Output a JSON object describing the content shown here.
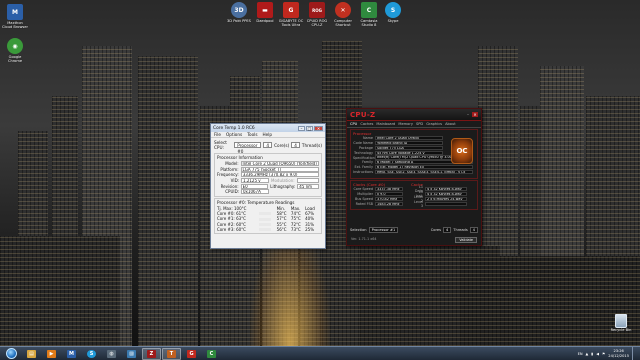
{
  "desktop_icons_left": [
    {
      "label": "Maxthon Cloud Browser",
      "glyph": "M",
      "color": "#2b5fa8",
      "icon": "maxthon-icon"
    },
    {
      "label": "Google Chrome",
      "glyph": "◉",
      "color": "#3a9a3a",
      "icon": "chrome-icon"
    }
  ],
  "desktop_icons_top": [
    {
      "label": "3D Pokt PPES",
      "glyph": "3D",
      "color": "#4a6fa0",
      "icon": "app-icon"
    },
    {
      "label": "Daedpool",
      "glyph": "▬",
      "color": "#b01a1a",
      "icon": "game-icon"
    },
    {
      "label": "GIGABYTE OC Tools Ultra",
      "glyph": "G",
      "color": "#c0281e",
      "icon": "gigabyte-icon"
    },
    {
      "label": "CPUID ROG CPU-Z",
      "glyph": "ROG",
      "color": "#9e1a1a",
      "icon": "cpuz-icon"
    },
    {
      "label": "Computer Shortcut",
      "glyph": "✕",
      "color": "#c03020",
      "icon": "computer-icon"
    },
    {
      "label": "Camtasia Studio 8",
      "glyph": "C",
      "color": "#2f8a3e",
      "icon": "camtasia-icon"
    },
    {
      "label": "Skype",
      "glyph": "S",
      "color": "#1f9ad8",
      "icon": "skype-icon"
    }
  ],
  "coretemp": {
    "title": "Core Temp 1.0 RC6",
    "menu": [
      "File",
      "Options",
      "Tools",
      "Help"
    ],
    "select_cpu_label": "Select CPU:",
    "select_cpu_value": "Processor #0",
    "cores_value": "4",
    "cores_label": "Core(s)",
    "threads_value": "4",
    "threads_label": "Thread(s)",
    "info_header": "Processor Information",
    "model_label": "Model:",
    "model_value": "Intel Core 2 Quad (Q9650) (Yorkfield)",
    "platform_label": "Platform:",
    "platform_value": "LGA 775 (Socket T)",
    "frequency_label": "Frequency:",
    "frequency_value": "3336.29MHz (370.82 x 9.0)",
    "vid_label": "VID:",
    "vid_value": "1.2125 v",
    "modulation_label": "Modulation:",
    "revision_label": "Revision:",
    "revision_value": "E0",
    "lithography_label": "Lithography:",
    "lithography_value": "45 nm",
    "cpuid_label": "CPUID:",
    "cpuid_value": "0x1067A",
    "temps_header": "Processor #0: Temperature Readings",
    "tj_label": "Tj. Max:",
    "tj_value": "100°C",
    "col_min": "Min.",
    "col_max": "Max.",
    "col_load": "Load",
    "cores": [
      {
        "name": "Core #0:",
        "temp": "61°C",
        "min": "58°C",
        "max": "74°C",
        "load": "67%"
      },
      {
        "name": "Core #1:",
        "temp": "63°C",
        "min": "57°C",
        "max": "75°C",
        "load": "40%"
      },
      {
        "name": "Core #2:",
        "temp": "60°C",
        "min": "55°C",
        "max": "72°C",
        "load": "31%"
      },
      {
        "name": "Core #3:",
        "temp": "60°C",
        "min": "56°C",
        "max": "73°C",
        "load": "25%"
      }
    ]
  },
  "cpuz": {
    "logo": "CPU-Z",
    "tabs": [
      "CPU",
      "Caches",
      "Mainboard",
      "Memory",
      "SPD",
      "Graphics",
      "About"
    ],
    "processor_caption": "Processor",
    "rows": [
      {
        "k": "Name",
        "v": "Intel Core 2 Quad Q9650"
      },
      {
        "k": "Code Name",
        "v": "Yorkfield       Brand ID"
      },
      {
        "k": "Package",
        "v": "Socket 775 LGA"
      },
      {
        "k": "Technology",
        "v": "45 nm    Core Voltage   1.224 V"
      },
      {
        "k": "Specification",
        "v": "Intel(R) Core(TM)2 Quad CPU Q9650 @ 3.00GHz"
      },
      {
        "k": "Family",
        "v": "6     Model  7     Stepping  A"
      },
      {
        "k": "Ext. Family",
        "v": "6     Ext. Model  17     Revision  E0"
      },
      {
        "k": "Instructions",
        "v": "MMX, SSE, SSE2, SSE3, SSSE3, SSE4.1, EM64T, VT-x"
      }
    ],
    "clocks_caption": "Clocks (Core #0)",
    "cache_caption": "Cache",
    "clock_rows": [
      {
        "k": "Core Speed",
        "v": "3337.38 MHz",
        "k2": "L1 Data",
        "v2": "4 x 32 KBytes  8-way"
      },
      {
        "k": "Multiplier",
        "v": "x 9.0",
        "k2": "L1 Inst.",
        "v2": "4 x 32 KBytes  8-way"
      },
      {
        "k": "Bus Speed",
        "v": "370.82 MHz",
        "k2": "Level 2",
        "v2": "2 x 6 MBytes  24-way"
      },
      {
        "k": "Rated FSB",
        "v": "1483.28 MHz",
        "k2": "Level 3",
        "v2": ""
      }
    ],
    "selection_label": "Selection",
    "selection_value": "Processor #1",
    "cores_label": "Cores",
    "cores_value": "4",
    "threads_label": "Threads",
    "threads_value": "4",
    "version": "Ver. 1.71.1 x64",
    "validate_label": "Validate",
    "oc_badge": "OC"
  },
  "recycle_bin_label": "Recycle Bin",
  "taskbar": {
    "items": [
      {
        "icon": "explorer-icon",
        "glyph": "▤",
        "color": "#d7a640",
        "active": false
      },
      {
        "icon": "media-player-icon",
        "glyph": "▶",
        "color": "#e07b18",
        "active": false
      },
      {
        "icon": "maxthon-icon",
        "glyph": "M",
        "color": "#2b5fa8",
        "active": false
      },
      {
        "icon": "skype-icon",
        "glyph": "S",
        "color": "#1f9ad8",
        "active": false
      },
      {
        "icon": "media-icon",
        "glyph": "◍",
        "color": "#5a6b7a",
        "active": false
      },
      {
        "icon": "image-viewer-icon",
        "glyph": "▨",
        "color": "#3a7ab0",
        "active": false
      },
      {
        "icon": "cpuz-icon",
        "glyph": "Z",
        "color": "#9e1a1a",
        "active": true
      },
      {
        "icon": "coretemp-icon",
        "glyph": "T",
        "color": "#c06020",
        "active": true
      },
      {
        "icon": "gigabyte-icon",
        "glyph": "G",
        "color": "#c0281e",
        "active": false
      },
      {
        "icon": "camtasia-icon",
        "glyph": "C",
        "color": "#2f8a3e",
        "active": false
      }
    ],
    "tray_lang": "EN",
    "time": "23:26",
    "date": "24/12/2015"
  }
}
